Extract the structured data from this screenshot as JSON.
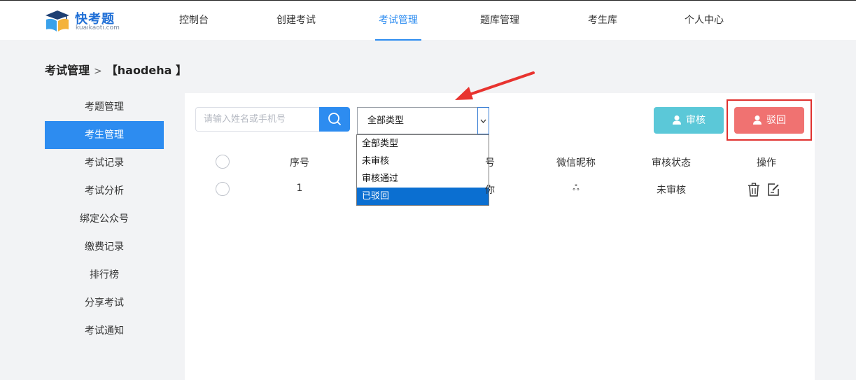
{
  "logo": {
    "brand": "快考题",
    "domain": "kuaikaoti.com"
  },
  "nav": {
    "items": [
      "控制台",
      "创建考试",
      "考试管理",
      "题库管理",
      "考生库",
      "个人中心"
    ],
    "active": "考试管理"
  },
  "breadcrumb": {
    "root": "考试管理",
    "separator": ">",
    "current": "【haodeha 】"
  },
  "sidebar": {
    "items": [
      "考题管理",
      "考生管理",
      "考试记录",
      "考试分析",
      "绑定公众号",
      "缴费记录",
      "排行榜",
      "分享考试",
      "考试通知"
    ],
    "active": "考生管理"
  },
  "toolbar": {
    "search_placeholder": "请输入姓名或手机号",
    "select_value": "全部类型",
    "options": [
      "全部类型",
      "未审核",
      "审核通过",
      "已驳回"
    ],
    "highlighted_option": "已驳回",
    "approve_label": "审核",
    "reject_label": "驳回"
  },
  "table": {
    "headers": {
      "index": "序号",
      "phone_partial": "号",
      "nickname": "微信昵称",
      "status": "审核状态",
      "actions": "操作"
    },
    "rows": [
      {
        "index": "1",
        "phone_partial": "你",
        "nickname": "ஃ",
        "status": "未审核"
      }
    ]
  },
  "colors": {
    "primary": "#2d8cf0",
    "approve": "#5bc8d8",
    "reject": "#f07271",
    "highlight_border": "#e0312f",
    "arrow": "#e8332f"
  }
}
